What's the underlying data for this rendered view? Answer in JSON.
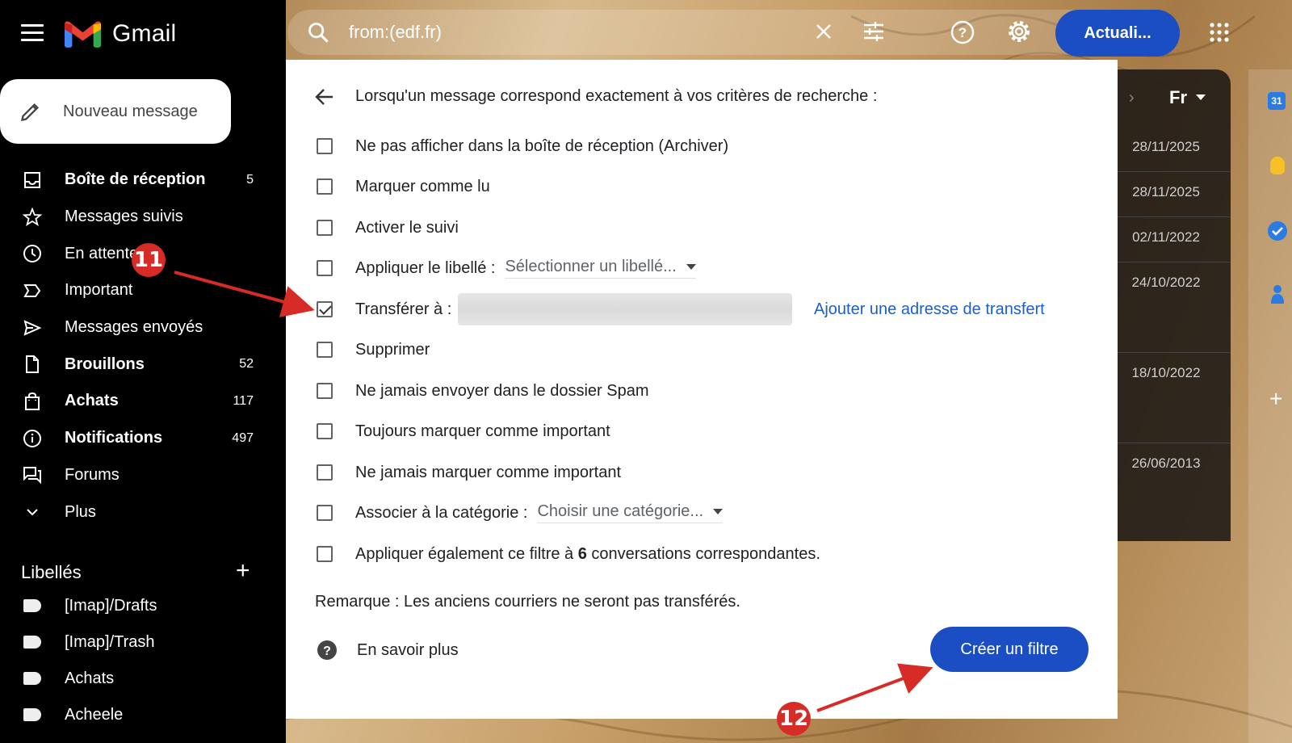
{
  "app": {
    "name": "Gmail",
    "compose_label": "Nouveau message"
  },
  "sidebar": {
    "items": [
      {
        "label": "Boîte de réception",
        "count": "5",
        "bold": true,
        "icon": "inbox-icon"
      },
      {
        "label": "Messages suivis",
        "count": "",
        "bold": false,
        "icon": "star-icon"
      },
      {
        "label": "En attente",
        "count": "",
        "bold": false,
        "icon": "clock-icon"
      },
      {
        "label": "Important",
        "count": "",
        "bold": false,
        "icon": "important-icon"
      },
      {
        "label": "Messages envoyés",
        "count": "",
        "bold": false,
        "icon": "send-icon"
      },
      {
        "label": "Brouillons",
        "count": "52",
        "bold": true,
        "icon": "draft-icon"
      },
      {
        "label": "Achats",
        "count": "117",
        "bold": true,
        "icon": "shopping-bag-icon"
      },
      {
        "label": "Notifications",
        "count": "497",
        "bold": true,
        "icon": "info-icon"
      },
      {
        "label": "Forums",
        "count": "",
        "bold": false,
        "icon": "forum-icon"
      },
      {
        "label": "Plus",
        "count": "",
        "bold": false,
        "icon": "chevron-down-icon"
      }
    ],
    "labels_heading": "Libellés",
    "labels": [
      "[Imap]/Drafts",
      "[Imap]/Trash",
      "Achats",
      "Acheele"
    ]
  },
  "topbar": {
    "search_query": "from:(edf.fr)",
    "update_button": "Actuali..."
  },
  "message_list": {
    "language": "Fr",
    "dates": [
      "28/11/2025",
      "28/11/2025",
      "02/11/2022",
      "24/10/2022",
      "18/10/2022",
      "26/06/2013"
    ]
  },
  "rail": {
    "calendar_day": "31"
  },
  "dialog": {
    "title": "Lorsqu'un message correspond exactement à vos critères de recherche :",
    "options": [
      {
        "label": "Ne pas afficher dans la boîte de réception (Archiver)",
        "checked": false
      },
      {
        "label": "Marquer comme lu",
        "checked": false
      },
      {
        "label": "Activer le suivi",
        "checked": false
      },
      {
        "label": "Appliquer le libellé :",
        "checked": false,
        "select": "Sélectionner un libellé..."
      },
      {
        "label": "Transférer à :",
        "checked": true
      },
      {
        "label": "Supprimer",
        "checked": false
      },
      {
        "label": "Ne jamais envoyer dans le dossier Spam",
        "checked": false
      },
      {
        "label": "Toujours marquer comme important",
        "checked": false
      },
      {
        "label": "Ne jamais marquer comme important",
        "checked": false
      },
      {
        "label": "Associer à la catégorie :",
        "checked": false,
        "select": "Choisir une catégorie..."
      },
      {
        "label_prefix": "Appliquer également ce filtre à",
        "label_count": "6",
        "label_suffix": "conversations correspondantes.",
        "checked": false
      }
    ],
    "add_forward_link": "Ajouter une adresse de transfert",
    "note": "Remarque : Les anciens courriers ne seront pas transférés.",
    "learn_more": "En savoir plus",
    "create_button": "Créer un filtre"
  },
  "annotations": {
    "step_a": "11",
    "step_b": "12",
    "color": "#d72b28"
  }
}
